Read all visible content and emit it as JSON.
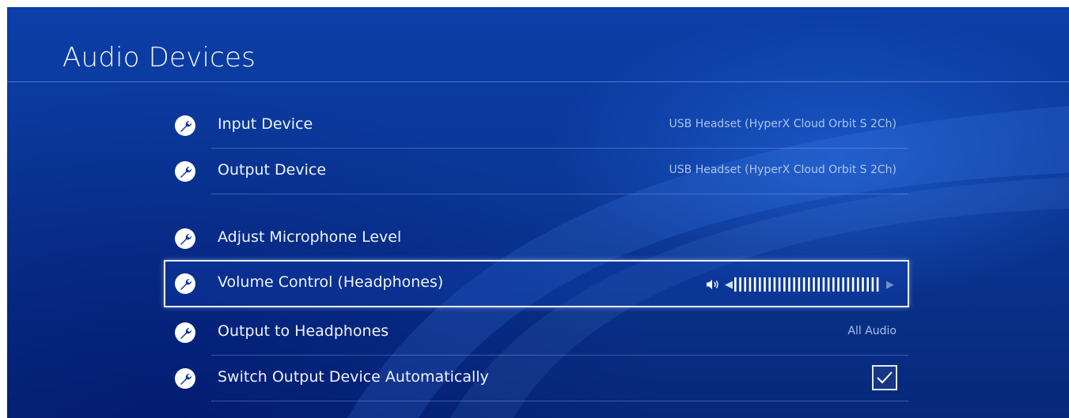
{
  "screen": {
    "title": "Audio Devices"
  },
  "settings": [
    {
      "label": "Input Device",
      "value": "USB Headset (HyperX Cloud Orbit S 2Ch)",
      "icon": "wrench-icon"
    },
    {
      "label": "Output Device",
      "value": "USB Headset (HyperX Cloud Orbit S 2Ch)",
      "icon": "wrench-icon"
    },
    {
      "label": "Adjust Microphone Level",
      "icon": "wrench-icon"
    },
    {
      "label": "Volume Control (Headphones)",
      "icon": "wrench-icon",
      "volume_level": 1.0,
      "selected": true
    },
    {
      "label": "Output to Headphones",
      "value": "All Audio",
      "icon": "wrench-icon"
    },
    {
      "label": "Switch Output Device Automatically",
      "icon": "wrench-icon",
      "checked": true
    }
  ],
  "colors": {
    "background": "#0a3796",
    "text": "#eef3ff",
    "value_text": "#c8d7f5",
    "focus_border": "#e8eefc"
  }
}
